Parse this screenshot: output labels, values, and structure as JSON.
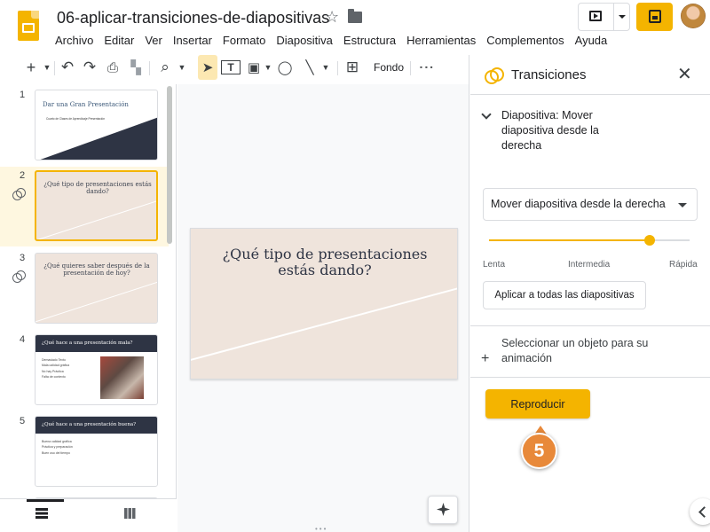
{
  "doc": {
    "title": "06-aplicar-transiciones-de-diapositivas"
  },
  "menu": [
    "Archivo",
    "Editar",
    "Ver",
    "Insertar",
    "Formato",
    "Diapositiva",
    "Estructura",
    "Herramientas",
    "Complementos",
    "Ayuda"
  ],
  "toolbar": {
    "add": "+",
    "undo": "↶",
    "redo": "↷",
    "print": "⎙",
    "paint": "▚",
    "zoom": "⌕",
    "select": "➤",
    "textbox": "T",
    "image": "▣",
    "shape": "◯",
    "line": "╲",
    "comment": "⊞",
    "fondo_label": "Fondo",
    "more": "⋮"
  },
  "filmstrip": {
    "slides": [
      {
        "number": "1",
        "title": "Dar una Gran Presentación",
        "subtitle": "Cuarto de Clases de Aprendizaje Presentación"
      },
      {
        "number": "2",
        "title": "¿Qué tipo de presentaciones estás dando?"
      },
      {
        "number": "3",
        "title": "¿Qué quieres saber después de la presentación de hoy?"
      },
      {
        "number": "4",
        "title": "¿Qué hace a una presentación mala?",
        "bullets": [
          "Demasiado Texto",
          "Mala calidad gráfica",
          "No hay Práctica",
          "Falta de contexto"
        ]
      },
      {
        "number": "5",
        "title": "¿Qué hace a una presentación buena?",
        "bullets": [
          "Buena calidad gráfica",
          "Práctica y preparación",
          "Buen uso del tiempo"
        ]
      }
    ]
  },
  "canvas": {
    "slide_title": "¿Qué tipo de presentaciones estás dando?"
  },
  "panel": {
    "title": "Transiciones",
    "close": "✕",
    "section_title": "Diapositiva: Mover diapositiva desde la derecha",
    "transition_select": "Mover diapositiva desde la derecha",
    "speed_value": 0.8,
    "speed_labels": {
      "slow": "Lenta",
      "mid": "Intermedia",
      "fast": "Rápida"
    },
    "apply_all": "Aplicar a todas las diapositivas",
    "select_object": "Seleccionar un objeto para su animación",
    "plus": "+",
    "play": "Reproducir",
    "callout": "5"
  },
  "colors": {
    "accent": "#f4b400",
    "callout": "#e8893a",
    "slide_bg": "#efe4dc",
    "dark": "#2e3444"
  }
}
